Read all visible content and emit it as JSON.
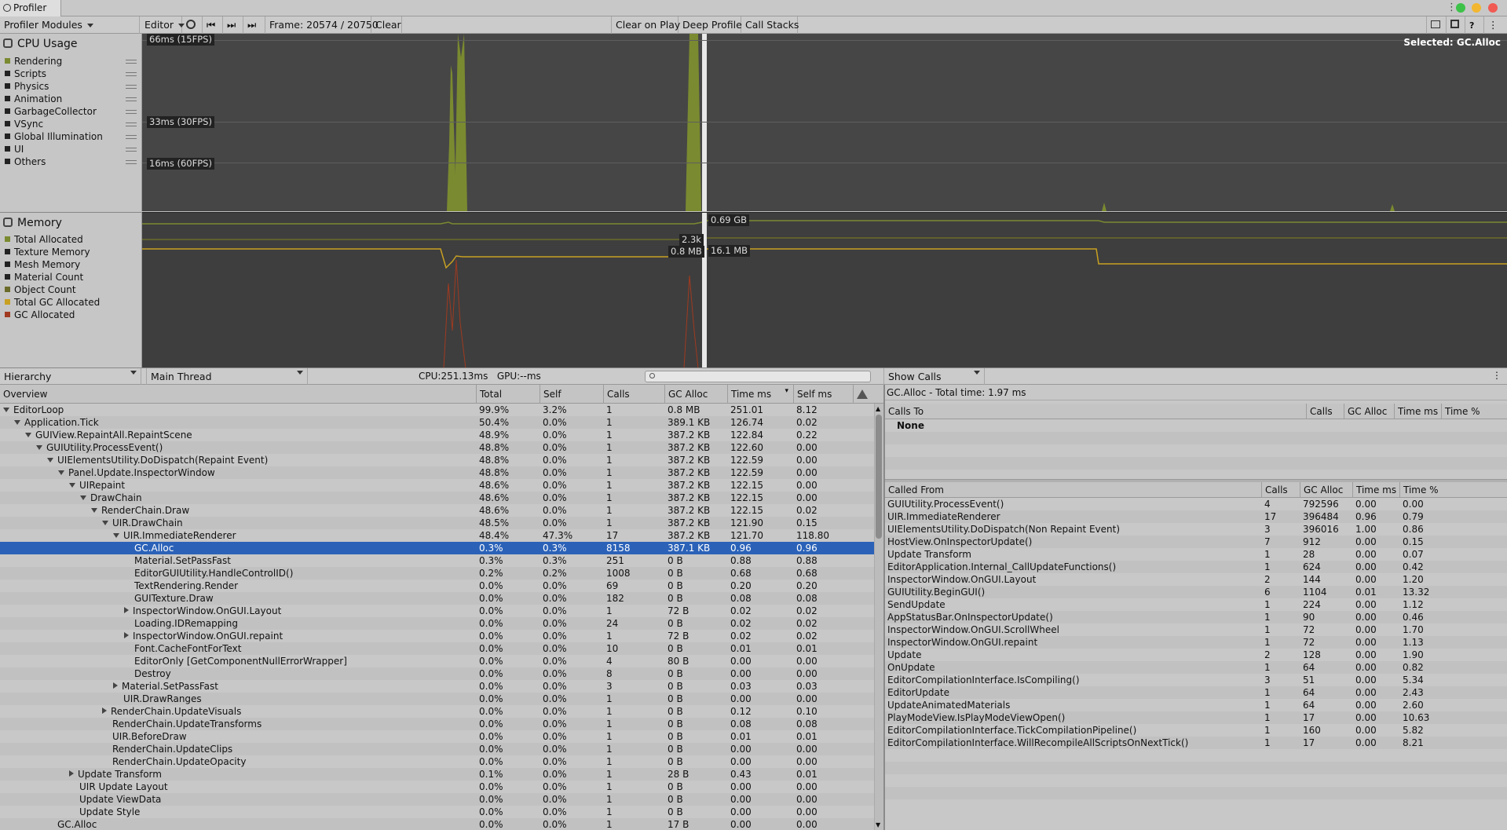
{
  "window": {
    "title": "Profiler"
  },
  "toolbar": {
    "modules_label": "Profiler Modules",
    "target_label": "Editor",
    "frame_label": "Frame: 20574 / 20750",
    "clear_label": "Clear",
    "clear_on_play_label": "Clear on Play",
    "deep_profile_label": "Deep Profile",
    "call_stacks_label": "Call Stacks"
  },
  "cpu": {
    "title": "CPU Usage",
    "selected_label": "Selected: GC.Alloc",
    "gridlines": [
      "66ms (15FPS)",
      "33ms (30FPS)",
      "16ms (60FPS)"
    ],
    "legend": [
      {
        "label": "Rendering",
        "color": "#7a8a30"
      },
      {
        "label": "Scripts",
        "color": "#222222"
      },
      {
        "label": "Physics",
        "color": "#222222"
      },
      {
        "label": "Animation",
        "color": "#222222"
      },
      {
        "label": "GarbageCollector",
        "color": "#222222"
      },
      {
        "label": "VSync",
        "color": "#222222"
      },
      {
        "label": "Global Illumination",
        "color": "#222222"
      },
      {
        "label": "UI",
        "color": "#222222"
      },
      {
        "label": "Others",
        "color": "#222222"
      }
    ]
  },
  "memory": {
    "title": "Memory",
    "value_labels": [
      "0.69 GB",
      "2.3k",
      "0.8 MB",
      "16.1 MB"
    ],
    "legend": [
      {
        "label": "Total Allocated",
        "color": "#7a8a30"
      },
      {
        "label": "Texture Memory",
        "color": "#222222"
      },
      {
        "label": "Mesh Memory",
        "color": "#222222"
      },
      {
        "label": "Material Count",
        "color": "#222222"
      },
      {
        "label": "Object Count",
        "color": "#6b6b2a"
      },
      {
        "label": "Total GC Allocated",
        "color": "#c8a022"
      },
      {
        "label": "GC Allocated",
        "color": "#a03a20"
      }
    ]
  },
  "bottom": {
    "view_label": "Hierarchy",
    "thread_label": "Main Thread",
    "cpu_gpu_label": "CPU:251.13ms   GPU:--ms",
    "show_calls_label": "Show Calls"
  },
  "hierarchy": {
    "headers": [
      "Overview",
      "Total",
      "Self",
      "Calls",
      "GC Alloc",
      "Time ms",
      "Self ms"
    ],
    "rows": [
      {
        "depth": 0,
        "exp": "open",
        "name": "EditorLoop",
        "total": "99.9%",
        "self": "3.2%",
        "calls": "1",
        "gc": "0.8 MB",
        "time": "251.01",
        "selfms": "8.12"
      },
      {
        "depth": 1,
        "exp": "open",
        "name": "Application.Tick",
        "total": "50.4%",
        "self": "0.0%",
        "calls": "1",
        "gc": "389.1 KB",
        "time": "126.74",
        "selfms": "0.02"
      },
      {
        "depth": 2,
        "exp": "open",
        "name": "GUIView.RepaintAll.RepaintScene",
        "total": "48.9%",
        "self": "0.0%",
        "calls": "1",
        "gc": "387.2 KB",
        "time": "122.84",
        "selfms": "0.22"
      },
      {
        "depth": 3,
        "exp": "open",
        "name": "GUIUtility.ProcessEvent()",
        "total": "48.8%",
        "self": "0.0%",
        "calls": "1",
        "gc": "387.2 KB",
        "time": "122.60",
        "selfms": "0.00"
      },
      {
        "depth": 4,
        "exp": "open",
        "name": "UIElementsUtility.DoDispatch(Repaint Event)",
        "total": "48.8%",
        "self": "0.0%",
        "calls": "1",
        "gc": "387.2 KB",
        "time": "122.59",
        "selfms": "0.00"
      },
      {
        "depth": 5,
        "exp": "open",
        "name": "Panel.Update.InspectorWindow",
        "total": "48.8%",
        "self": "0.0%",
        "calls": "1",
        "gc": "387.2 KB",
        "time": "122.59",
        "selfms": "0.00"
      },
      {
        "depth": 6,
        "exp": "open",
        "name": "UIRepaint",
        "total": "48.6%",
        "self": "0.0%",
        "calls": "1",
        "gc": "387.2 KB",
        "time": "122.15",
        "selfms": "0.00"
      },
      {
        "depth": 7,
        "exp": "open",
        "name": "DrawChain",
        "total": "48.6%",
        "self": "0.0%",
        "calls": "1",
        "gc": "387.2 KB",
        "time": "122.15",
        "selfms": "0.00"
      },
      {
        "depth": 8,
        "exp": "open",
        "name": "RenderChain.Draw",
        "total": "48.6%",
        "self": "0.0%",
        "calls": "1",
        "gc": "387.2 KB",
        "time": "122.15",
        "selfms": "0.02"
      },
      {
        "depth": 9,
        "exp": "open",
        "name": "UIR.DrawChain",
        "total": "48.5%",
        "self": "0.0%",
        "calls": "1",
        "gc": "387.2 KB",
        "time": "121.90",
        "selfms": "0.15"
      },
      {
        "depth": 10,
        "exp": "open",
        "name": "UIR.ImmediateRenderer",
        "total": "48.4%",
        "self": "47.3%",
        "calls": "17",
        "gc": "387.2 KB",
        "time": "121.70",
        "selfms": "118.80"
      },
      {
        "depth": 11,
        "exp": "",
        "name": "GC.Alloc",
        "total": "0.3%",
        "self": "0.3%",
        "calls": "8158",
        "gc": "387.1 KB",
        "time": "0.96",
        "selfms": "0.96",
        "selected": true
      },
      {
        "depth": 11,
        "exp": "",
        "name": "Material.SetPassFast",
        "total": "0.3%",
        "self": "0.3%",
        "calls": "251",
        "gc": "0 B",
        "time": "0.88",
        "selfms": "0.88"
      },
      {
        "depth": 11,
        "exp": "",
        "name": "EditorGUIUtility.HandleControlID()",
        "total": "0.2%",
        "self": "0.2%",
        "calls": "1008",
        "gc": "0 B",
        "time": "0.68",
        "selfms": "0.68"
      },
      {
        "depth": 11,
        "exp": "",
        "name": "TextRendering.Render",
        "total": "0.0%",
        "self": "0.0%",
        "calls": "69",
        "gc": "0 B",
        "time": "0.20",
        "selfms": "0.20"
      },
      {
        "depth": 11,
        "exp": "",
        "name": "GUITexture.Draw",
        "total": "0.0%",
        "self": "0.0%",
        "calls": "182",
        "gc": "0 B",
        "time": "0.08",
        "selfms": "0.08"
      },
      {
        "depth": 11,
        "exp": "closed",
        "name": "InspectorWindow.OnGUI.Layout",
        "total": "0.0%",
        "self": "0.0%",
        "calls": "1",
        "gc": "72 B",
        "time": "0.02",
        "selfms": "0.02"
      },
      {
        "depth": 11,
        "exp": "",
        "name": "Loading.IDRemapping",
        "total": "0.0%",
        "self": "0.0%",
        "calls": "24",
        "gc": "0 B",
        "time": "0.02",
        "selfms": "0.02"
      },
      {
        "depth": 11,
        "exp": "closed",
        "name": "InspectorWindow.OnGUI.repaint",
        "total": "0.0%",
        "self": "0.0%",
        "calls": "1",
        "gc": "72 B",
        "time": "0.02",
        "selfms": "0.02"
      },
      {
        "depth": 11,
        "exp": "",
        "name": "Font.CacheFontForText",
        "total": "0.0%",
        "self": "0.0%",
        "calls": "10",
        "gc": "0 B",
        "time": "0.01",
        "selfms": "0.01"
      },
      {
        "depth": 11,
        "exp": "",
        "name": "EditorOnly [GetComponentNullErrorWrapper]",
        "total": "0.0%",
        "self": "0.0%",
        "calls": "4",
        "gc": "80 B",
        "time": "0.00",
        "selfms": "0.00"
      },
      {
        "depth": 11,
        "exp": "",
        "name": "Destroy",
        "total": "0.0%",
        "self": "0.0%",
        "calls": "8",
        "gc": "0 B",
        "time": "0.00",
        "selfms": "0.00"
      },
      {
        "depth": 10,
        "exp": "closed",
        "name": "Material.SetPassFast",
        "total": "0.0%",
        "self": "0.0%",
        "calls": "3",
        "gc": "0 B",
        "time": "0.03",
        "selfms": "0.03"
      },
      {
        "depth": 10,
        "exp": "",
        "name": "UIR.DrawRanges",
        "total": "0.0%",
        "self": "0.0%",
        "calls": "1",
        "gc": "0 B",
        "time": "0.00",
        "selfms": "0.00"
      },
      {
        "depth": 9,
        "exp": "closed",
        "name": "RenderChain.UpdateVisuals",
        "total": "0.0%",
        "self": "0.0%",
        "calls": "1",
        "gc": "0 B",
        "time": "0.12",
        "selfms": "0.10"
      },
      {
        "depth": 9,
        "exp": "",
        "name": "RenderChain.UpdateTransforms",
        "total": "0.0%",
        "self": "0.0%",
        "calls": "1",
        "gc": "0 B",
        "time": "0.08",
        "selfms": "0.08"
      },
      {
        "depth": 9,
        "exp": "",
        "name": "UIR.BeforeDraw",
        "total": "0.0%",
        "self": "0.0%",
        "calls": "1",
        "gc": "0 B",
        "time": "0.01",
        "selfms": "0.01"
      },
      {
        "depth": 9,
        "exp": "",
        "name": "RenderChain.UpdateClips",
        "total": "0.0%",
        "self": "0.0%",
        "calls": "1",
        "gc": "0 B",
        "time": "0.00",
        "selfms": "0.00"
      },
      {
        "depth": 9,
        "exp": "",
        "name": "RenderChain.UpdateOpacity",
        "total": "0.0%",
        "self": "0.0%",
        "calls": "1",
        "gc": "0 B",
        "time": "0.00",
        "selfms": "0.00"
      },
      {
        "depth": 6,
        "exp": "closed",
        "name": "Update Transform",
        "total": "0.1%",
        "self": "0.0%",
        "calls": "1",
        "gc": "28 B",
        "time": "0.43",
        "selfms": "0.01"
      },
      {
        "depth": 6,
        "exp": "",
        "name": "UIR Update Layout",
        "total": "0.0%",
        "self": "0.0%",
        "calls": "1",
        "gc": "0 B",
        "time": "0.00",
        "selfms": "0.00"
      },
      {
        "depth": 6,
        "exp": "",
        "name": "Update ViewData",
        "total": "0.0%",
        "self": "0.0%",
        "calls": "1",
        "gc": "0 B",
        "time": "0.00",
        "selfms": "0.00"
      },
      {
        "depth": 6,
        "exp": "",
        "name": "Update Style",
        "total": "0.0%",
        "self": "0.0%",
        "calls": "1",
        "gc": "0 B",
        "time": "0.00",
        "selfms": "0.00"
      },
      {
        "depth": 4,
        "exp": "",
        "name": "GC.Alloc",
        "total": "0.0%",
        "self": "0.0%",
        "calls": "1",
        "gc": "17 B",
        "time": "0.00",
        "selfms": "0.00"
      }
    ]
  },
  "details": {
    "title": "GC.Alloc - Total time: 1.97 ms",
    "calls_to_headers": [
      "Calls To",
      "Calls",
      "GC Alloc",
      "Time ms",
      "Time %"
    ],
    "calls_to_empty": "None",
    "called_from_headers": [
      "Called From",
      "Calls",
      "GC Alloc",
      "Time ms",
      "Time %"
    ],
    "called_from": [
      {
        "name": "GUIUtility.ProcessEvent()",
        "calls": "4",
        "gc": "792596",
        "time": "0.00",
        "pct": "0.00"
      },
      {
        "name": "UIR.ImmediateRenderer",
        "calls": "17",
        "gc": "396484",
        "time": "0.96",
        "pct": "0.79"
      },
      {
        "name": "UIElementsUtility.DoDispatch(Non Repaint Event)",
        "calls": "3",
        "gc": "396016",
        "time": "1.00",
        "pct": "0.86"
      },
      {
        "name": "HostView.OnInspectorUpdate()",
        "calls": "7",
        "gc": "912",
        "time": "0.00",
        "pct": "0.15"
      },
      {
        "name": "Update Transform",
        "calls": "1",
        "gc": "28",
        "time": "0.00",
        "pct": "0.07"
      },
      {
        "name": "EditorApplication.Internal_CallUpdateFunctions()",
        "calls": "1",
        "gc": "624",
        "time": "0.00",
        "pct": "0.42"
      },
      {
        "name": "InspectorWindow.OnGUI.Layout",
        "calls": "2",
        "gc": "144",
        "time": "0.00",
        "pct": "1.20"
      },
      {
        "name": "GUIUtility.BeginGUI()",
        "calls": "6",
        "gc": "1104",
        "time": "0.01",
        "pct": "13.32"
      },
      {
        "name": "SendUpdate",
        "calls": "1",
        "gc": "224",
        "time": "0.00",
        "pct": "1.12"
      },
      {
        "name": "AppStatusBar.OnInspectorUpdate()",
        "calls": "1",
        "gc": "90",
        "time": "0.00",
        "pct": "0.46"
      },
      {
        "name": "InspectorWindow.OnGUI.ScrollWheel",
        "calls": "1",
        "gc": "72",
        "time": "0.00",
        "pct": "1.70"
      },
      {
        "name": "InspectorWindow.OnGUI.repaint",
        "calls": "1",
        "gc": "72",
        "time": "0.00",
        "pct": "1.13"
      },
      {
        "name": "Update",
        "calls": "2",
        "gc": "128",
        "time": "0.00",
        "pct": "1.90"
      },
      {
        "name": "OnUpdate",
        "calls": "1",
        "gc": "64",
        "time": "0.00",
        "pct": "0.82"
      },
      {
        "name": "EditorCompilationInterface.IsCompiling()",
        "calls": "3",
        "gc": "51",
        "time": "0.00",
        "pct": "5.34"
      },
      {
        "name": "EditorUpdate",
        "calls": "1",
        "gc": "64",
        "time": "0.00",
        "pct": "2.43"
      },
      {
        "name": "UpdateAnimatedMaterials",
        "calls": "1",
        "gc": "64",
        "time": "0.00",
        "pct": "2.60"
      },
      {
        "name": "PlayModeView.IsPlayModeViewOpen()",
        "calls": "1",
        "gc": "17",
        "time": "0.00",
        "pct": "10.63"
      },
      {
        "name": "EditorCompilationInterface.TickCompilationPipeline()",
        "calls": "1",
        "gc": "160",
        "time": "0.00",
        "pct": "5.82"
      },
      {
        "name": "EditorCompilationInterface.WillRecompileAllScriptsOnNextTick()",
        "calls": "1",
        "gc": "17",
        "time": "0.00",
        "pct": "8.21"
      }
    ]
  }
}
